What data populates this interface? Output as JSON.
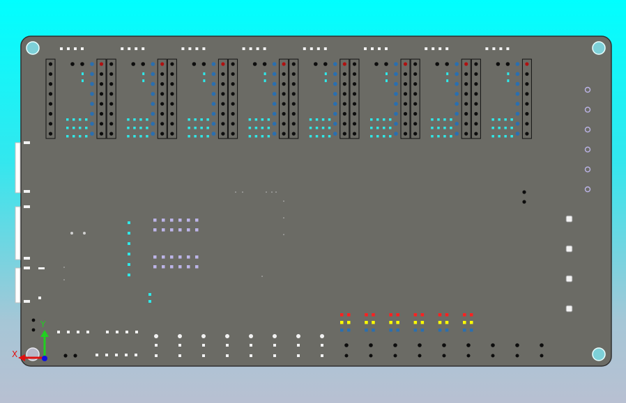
{
  "viewport": {
    "background_top": "#00ffff",
    "background_bottom": "#b8c0d2"
  },
  "board": {
    "fill": "#6b6b65",
    "outline": "#303030"
  },
  "triad": {
    "x_label": "X",
    "y_label": "Y",
    "x_color": "#e01010",
    "y_color": "#20d020",
    "z_color": "#1010e0"
  },
  "colors": {
    "cyan_pad": "#30e8e8",
    "blue_pad": "#2a6fb0",
    "dark_pad": "#0d0d0d",
    "white_pad": "#f2f2f2",
    "lavender_pad": "#bcb4e8",
    "red_pad": "#ff2020",
    "yellow_pad": "#ffff00",
    "connector_white": "#ffffff"
  },
  "display_modules": 8,
  "icons": [
    "axis-triad-icon",
    "mounting-hole-icon"
  ]
}
